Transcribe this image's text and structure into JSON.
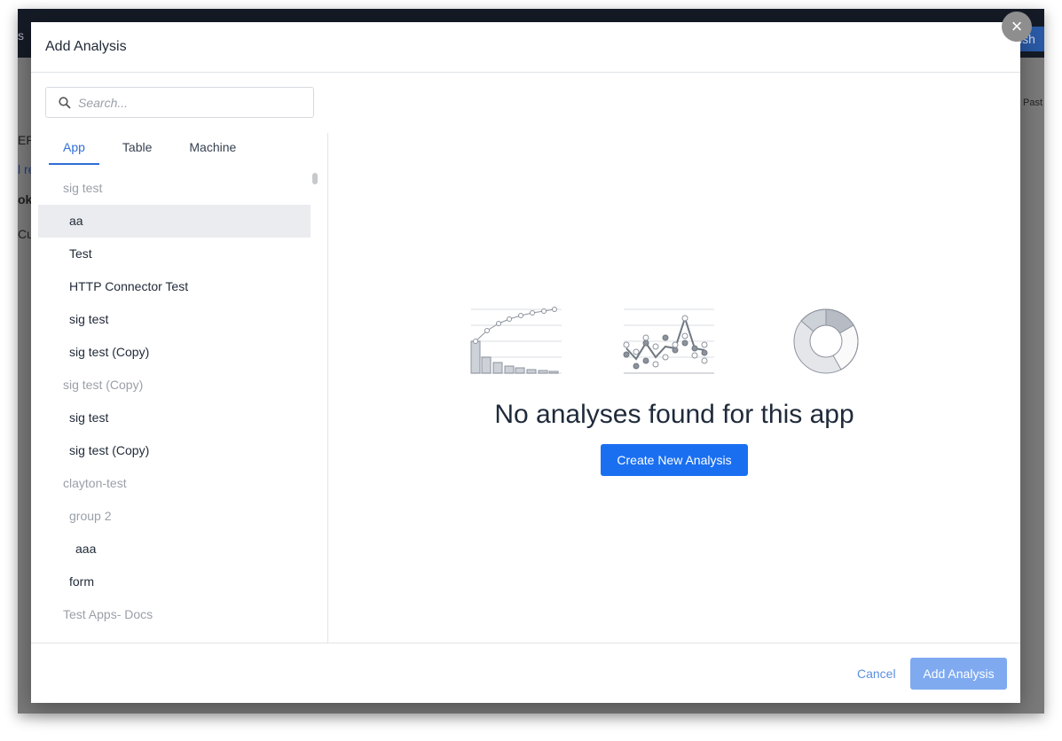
{
  "background_app": {
    "publish_fragment": "ish",
    "paste_fragment": "Past",
    "fragments": [
      "s",
      "EP",
      "l re",
      "ok",
      "Cu"
    ]
  },
  "dialog": {
    "title": "Add Analysis",
    "search": {
      "placeholder": "Search...",
      "value": ""
    },
    "tabs": [
      {
        "label": "App",
        "active": true
      },
      {
        "label": "Table"
      },
      {
        "label": "Machine"
      }
    ],
    "list": [
      {
        "label": "sig test",
        "type": "group",
        "level": 0
      },
      {
        "label": "aa",
        "type": "item",
        "level": 1,
        "selected": true
      },
      {
        "label": "Test",
        "type": "item",
        "level": 1
      },
      {
        "label": "HTTP Connector Test",
        "type": "item",
        "level": 1
      },
      {
        "label": "sig test",
        "type": "item",
        "level": 1
      },
      {
        "label": "sig test (Copy)",
        "type": "item",
        "level": 1
      },
      {
        "label": "sig test (Copy)",
        "type": "group",
        "level": 0
      },
      {
        "label": "sig test",
        "type": "item",
        "level": 1
      },
      {
        "label": "sig test (Copy)",
        "type": "item",
        "level": 1
      },
      {
        "label": "clayton-test",
        "type": "group",
        "level": 0
      },
      {
        "label": "group 2",
        "type": "group",
        "level": 1
      },
      {
        "label": "aaa",
        "type": "item",
        "level": 2
      },
      {
        "label": "form",
        "type": "item",
        "level": 1
      },
      {
        "label": "Test Apps- Docs",
        "type": "group",
        "level": 0
      }
    ],
    "empty_message": "No analyses found for this app",
    "create_button": "Create New Analysis",
    "cancel_button": "Cancel",
    "add_button": "Add Analysis",
    "colors": {
      "accent": "#1a6ff1",
      "add_disabled": "#7faaf0"
    }
  }
}
